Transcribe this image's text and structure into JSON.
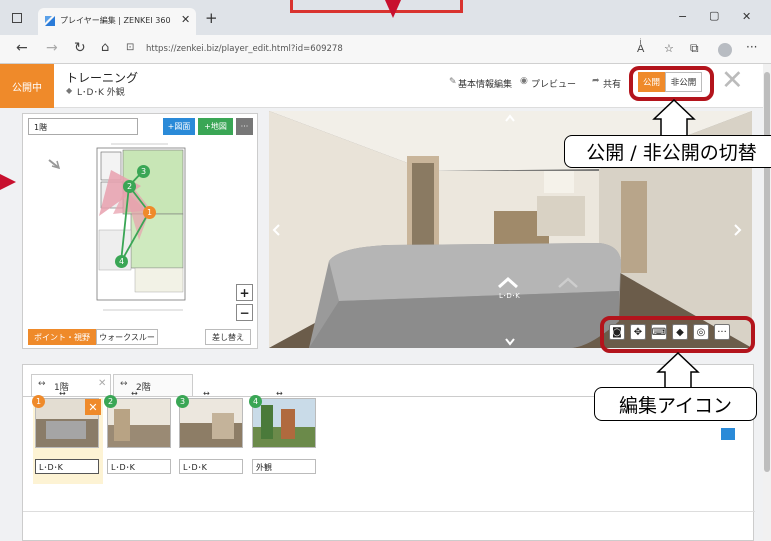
{
  "browser": {
    "tab_title": "プレイヤー編集 | ZENKEI 360",
    "new_tab": "+",
    "url": "https://zenkei.biz/player_edit.html?id=609278",
    "win_min": "−",
    "win_max": "▢",
    "win_close": "✕"
  },
  "header": {
    "status": "公開中",
    "title": "トレーニング",
    "tags": "L･D･K 外観",
    "edit_basic": "基本情報編集",
    "preview": "プレビュー",
    "share": "共有",
    "public": "公開",
    "private": "非公開"
  },
  "map": {
    "floor_input": "1階",
    "add_plan": "+図面",
    "add_map": "+地図",
    "more": "···",
    "zoom_in": "+",
    "zoom_out": "−",
    "mode_point": "ポイント・視野",
    "mode_walk": "ウォークスルー",
    "replace": "差し替え"
  },
  "viewer": {
    "hotspot_label": "L･D･K"
  },
  "floors": {
    "tab1": "1階",
    "tab2": "2階"
  },
  "scenes": [
    {
      "num": "1",
      "label": "L･D･K"
    },
    {
      "num": "2",
      "label": "L･D･K"
    },
    {
      "num": "3",
      "label": "L･D･K"
    },
    {
      "num": "4",
      "label": "外観"
    }
  ],
  "annotations": {
    "toggle": "公開 / 非公開の切替",
    "edit_icons": "編集アイコン"
  },
  "colors": {
    "accent": "#ef8a2a",
    "primary": "#2a8ad8",
    "green": "#3aa655",
    "callout_border": "#b3141c"
  }
}
